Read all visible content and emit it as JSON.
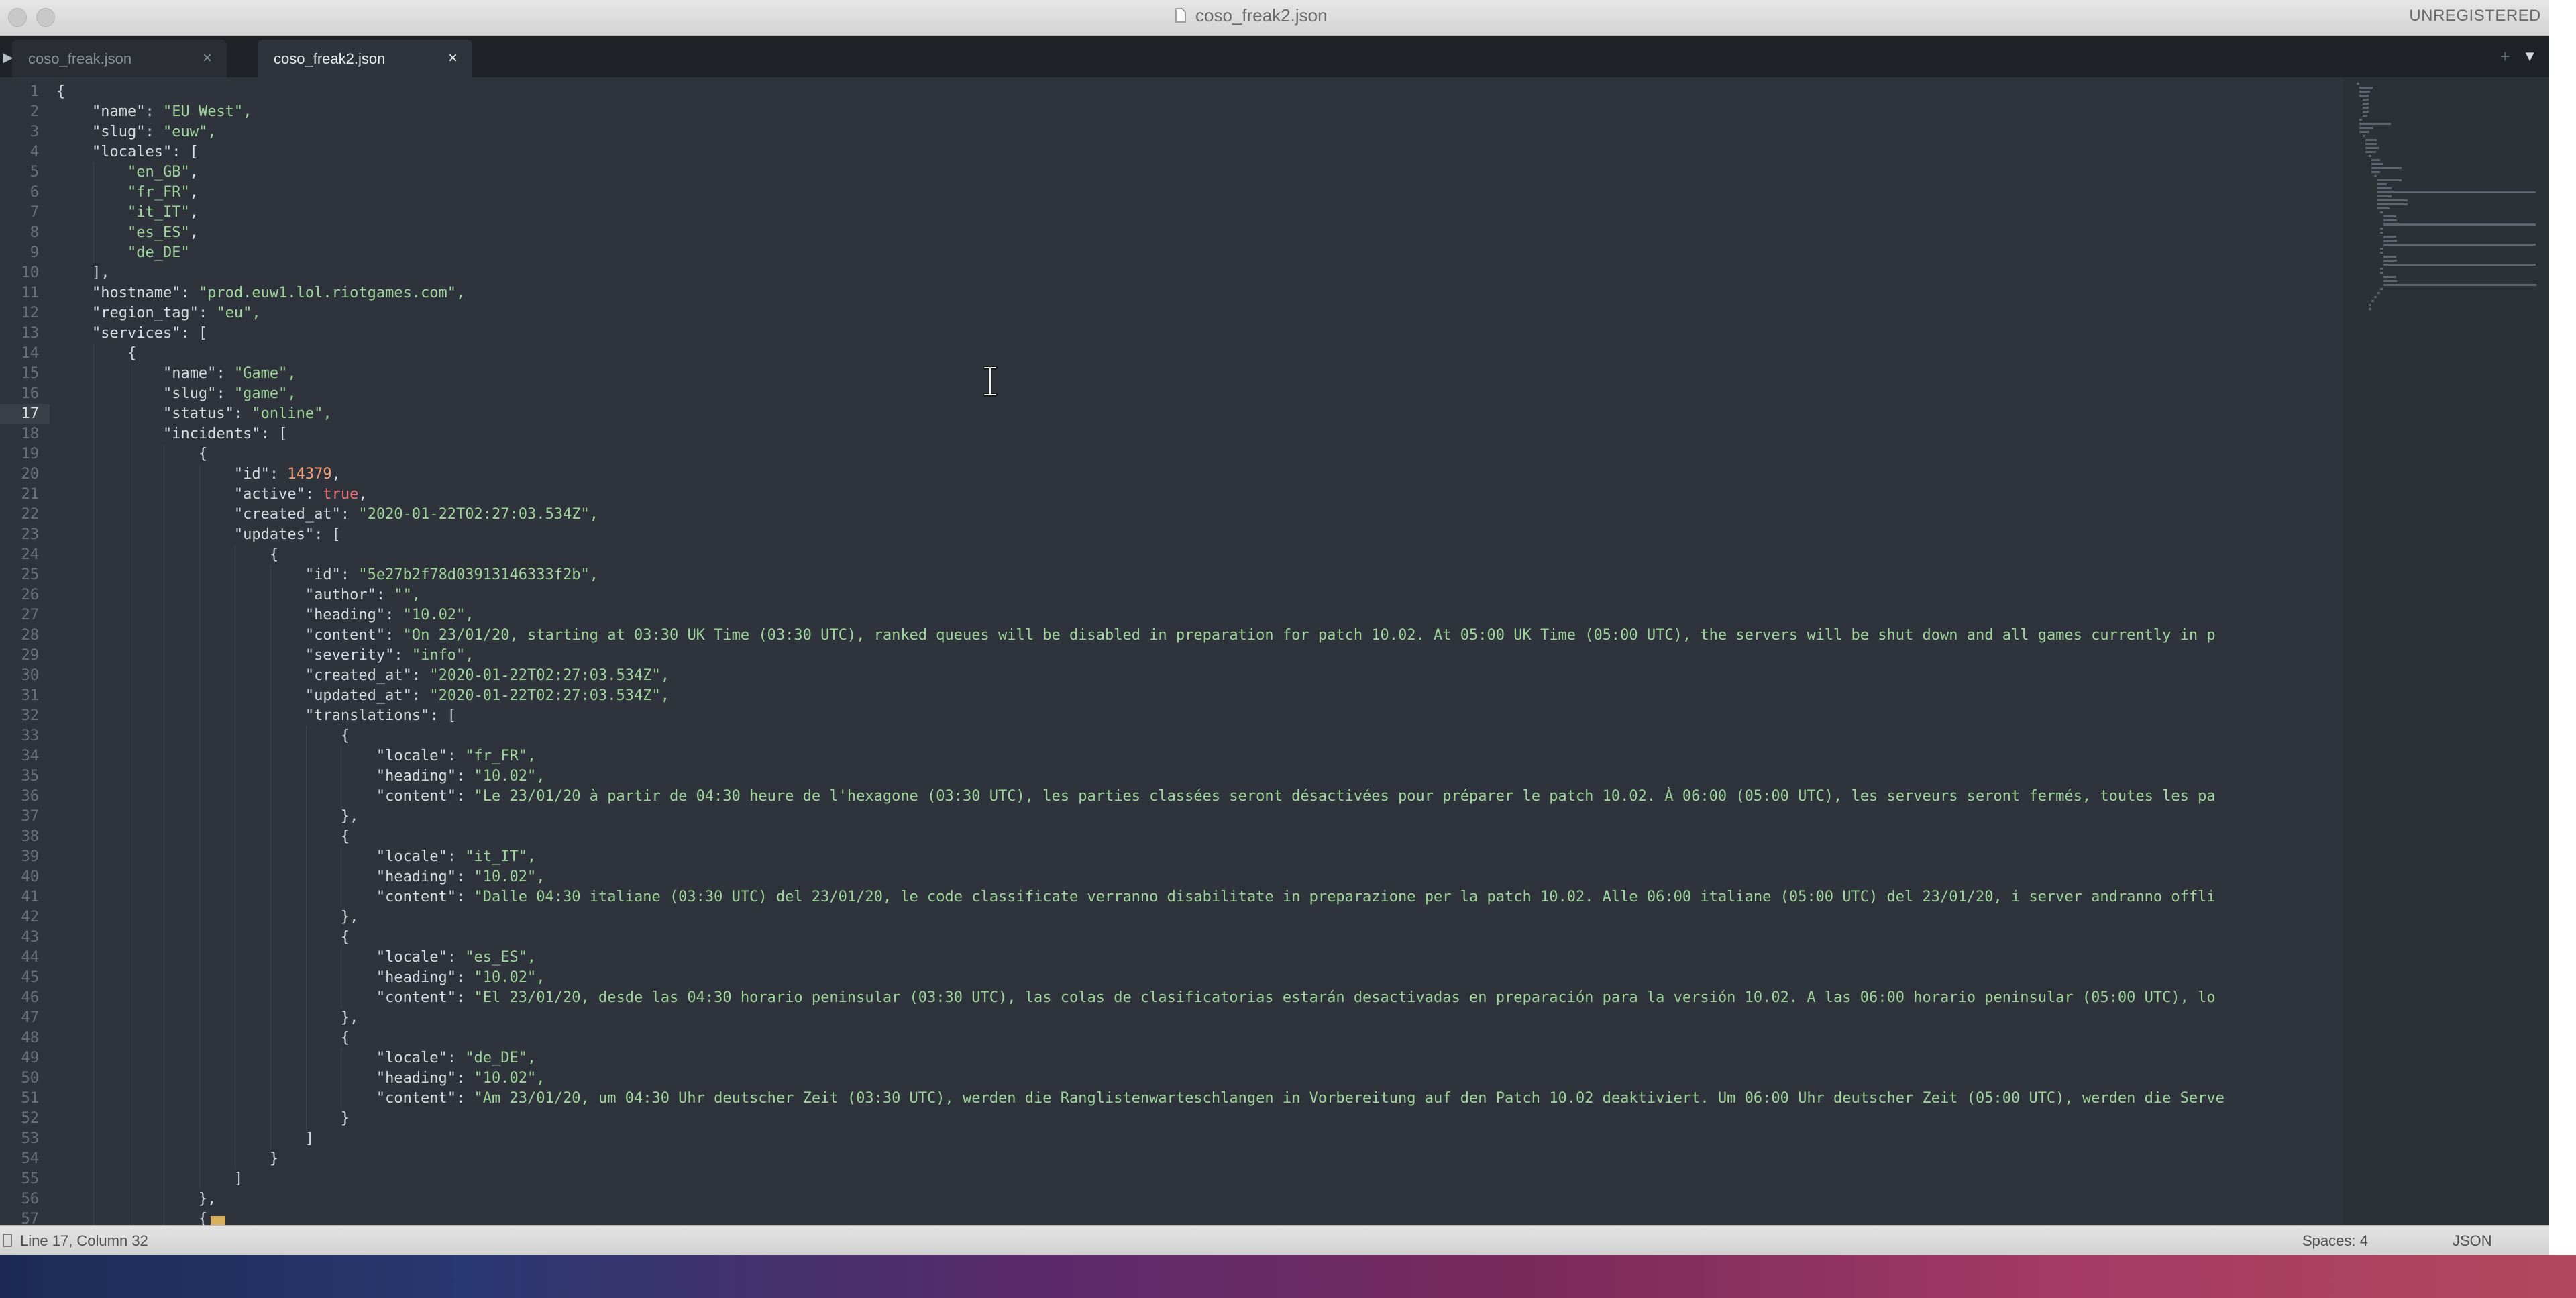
{
  "window": {
    "title": "coso_freak2.json",
    "license_label": "UNREGISTERED"
  },
  "tabs": [
    {
      "label": "coso_freak.json",
      "active": false
    },
    {
      "label": "coso_freak2.json",
      "active": true
    }
  ],
  "editor": {
    "current_line": 17,
    "tab_size": 4,
    "lines": [
      "{",
      "    \"name\": \"EU West\",",
      "    \"slug\": \"euw\",",
      "    \"locales\": [",
      "        \"en_GB\",",
      "        \"fr_FR\",",
      "        \"it_IT\",",
      "        \"es_ES\",",
      "        \"de_DE\"",
      "    ],",
      "    \"hostname\": \"prod.euw1.lol.riotgames.com\",",
      "    \"region_tag\": \"eu\",",
      "    \"services\": [",
      "        {",
      "            \"name\": \"Game\",",
      "            \"slug\": \"game\",",
      "            \"status\": \"online\",",
      "            \"incidents\": [",
      "                {",
      "                    \"id\": 14379,",
      "                    \"active\": true,",
      "                    \"created_at\": \"2020-01-22T02:27:03.534Z\",",
      "                    \"updates\": [",
      "                        {",
      "                            \"id\": \"5e27b2f78d03913146333f2b\",",
      "                            \"author\": \"\",",
      "                            \"heading\": \"10.02\",",
      "                            \"content\": \"On 23/01/20, starting at 03:30 UK Time (03:30 UTC), ranked queues will be disabled in preparation for patch 10.02. At 05:00 UK Time (05:00 UTC), the servers will be shut down and all games currently in p",
      "                            \"severity\": \"info\",",
      "                            \"created_at\": \"2020-01-22T02:27:03.534Z\",",
      "                            \"updated_at\": \"2020-01-22T02:27:03.534Z\",",
      "                            \"translations\": [",
      "                                {",
      "                                    \"locale\": \"fr_FR\",",
      "                                    \"heading\": \"10.02\",",
      "                                    \"content\": \"Le 23/01/20 à partir de 04:30 heure de l'hexagone (03:30 UTC), les parties classées seront désactivées pour préparer le patch 10.02. À 06:00 (05:00 UTC), les serveurs seront fermés, toutes les pa",
      "                                },",
      "                                {",
      "                                    \"locale\": \"it_IT\",",
      "                                    \"heading\": \"10.02\",",
      "                                    \"content\": \"Dalle 04:30 italiane (03:30 UTC) del 23/01/20, le code classificate verranno disabilitate in preparazione per la patch 10.02. Alle 06:00 italiane (05:00 UTC) del 23/01/20, i server andranno offli",
      "                                },",
      "                                {",
      "                                    \"locale\": \"es_ES\",",
      "                                    \"heading\": \"10.02\",",
      "                                    \"content\": \"El 23/01/20, desde las 04:30 horario peninsular (03:30 UTC), las colas de clasificatorias estarán desactivadas en preparación para la versión 10.02. A las 06:00 horario peninsular (05:00 UTC), lo",
      "                                },",
      "                                {",
      "                                    \"locale\": \"de_DE\",",
      "                                    \"heading\": \"10.02\",",
      "                                    \"content\": \"Am 23/01/20, um 04:30 Uhr deutscher Zeit (03:30 UTC), werden die Ranglistenwarteschlangen in Vorbereitung auf den Patch 10.02 deaktiviert. Um 06:00 Uhr deutscher Zeit (05:00 UTC), werden die Serve",
      "                                }",
      "                            ]",
      "                        }",
      "                    ]",
      "                },",
      "                {"
    ]
  },
  "statusbar": {
    "position": "Line 17, Column 32",
    "indentation": "Spaces: 4",
    "syntax": "JSON"
  },
  "colors": {
    "editor_bg": "#2f343c",
    "string": "#9fd49a",
    "number": "#f3a177",
    "boolean": "#f07178"
  },
  "icons": [
    "document-icon",
    "play-icon",
    "close-icon",
    "plus-icon",
    "dropdown-icon",
    "ibeam-cursor-icon"
  ]
}
